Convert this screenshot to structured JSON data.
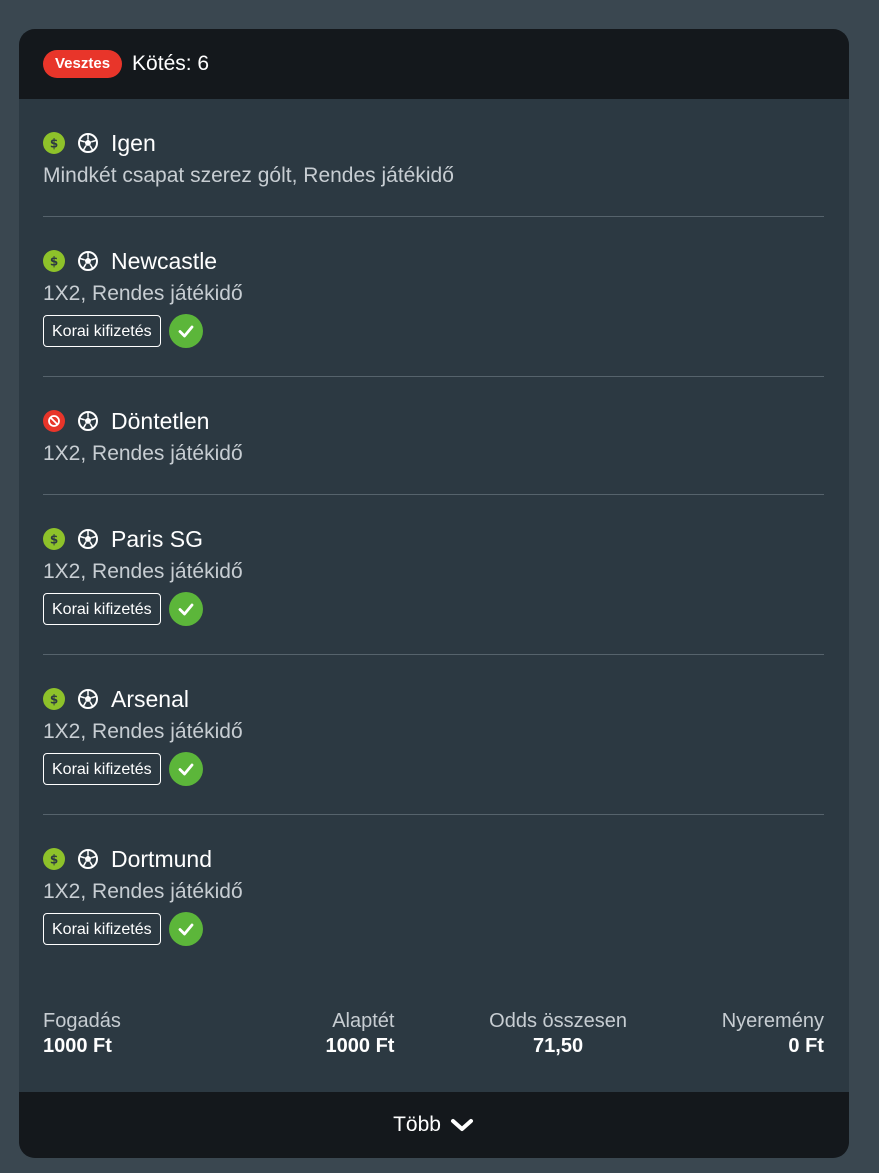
{
  "header": {
    "status_badge": "Vesztes",
    "bet_count_label": "Kötés: 6"
  },
  "selections": [
    {
      "name": "Igen",
      "market": "Mindkét csapat szerez gólt, Rendes játékidő",
      "status": "won",
      "cashout": false
    },
    {
      "name": "Newcastle",
      "market": "1X2, Rendes játékidő",
      "status": "won",
      "cashout": true
    },
    {
      "name": "Döntetlen",
      "market": "1X2, Rendes játékidő",
      "status": "lost",
      "cashout": false
    },
    {
      "name": "Paris SG",
      "market": "1X2, Rendes játékidő",
      "status": "won",
      "cashout": true
    },
    {
      "name": "Arsenal",
      "market": "1X2, Rendes játékidő",
      "status": "won",
      "cashout": true
    },
    {
      "name": "Dortmund",
      "market": "1X2, Rendes játékidő",
      "status": "won",
      "cashout": true
    }
  ],
  "cashout_label": "Korai kifizetés",
  "summary": {
    "bet_type_label": "Fogadás",
    "bet_type_value": "1000 Ft",
    "base_stake_label": "Alaptét",
    "base_stake_value": "1000 Ft",
    "total_odds_label": "Odds összesen",
    "total_odds_value": "71,50",
    "winnings_label": "Nyeremény",
    "winnings_value": "0 Ft"
  },
  "footer": {
    "more_label": "Több",
    "more_icon": "chevron-down-icon"
  },
  "icons": {
    "won": "dollar-icon",
    "lost": "cancel-icon",
    "sport": "soccer-ball-icon",
    "cashout_done": "check-icon"
  },
  "colors": {
    "background": "#3a4750",
    "card": "#2c3942",
    "header": "#14181c",
    "lost_badge": "#e8352a",
    "won_icon": "#8ec22a",
    "check": "#5cb63a"
  }
}
